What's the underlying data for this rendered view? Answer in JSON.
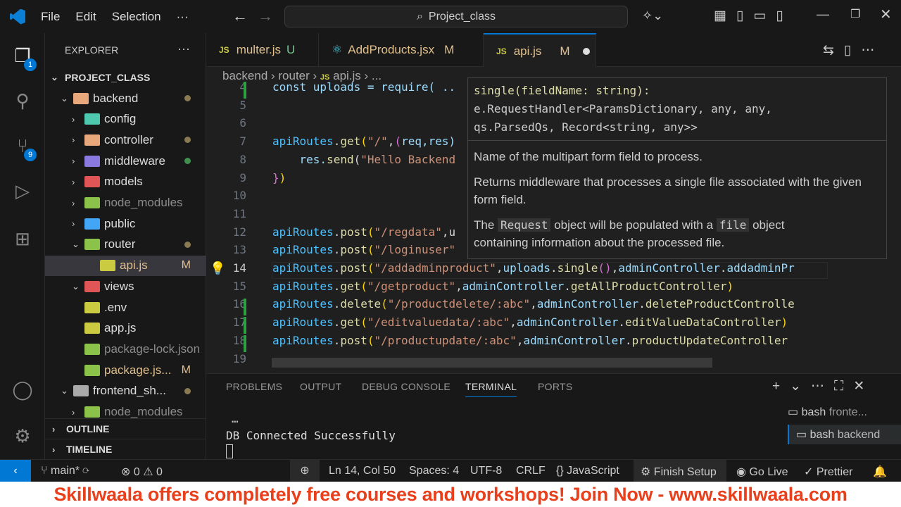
{
  "titlebar": {
    "menu": [
      "File",
      "Edit",
      "Selection",
      "···"
    ],
    "search": "Project_class"
  },
  "activity": {
    "explorer_badge": "1",
    "scm_badge": "9"
  },
  "sidebar": {
    "title": "EXPLORER",
    "more": "···",
    "project": "PROJECT_CLASS",
    "items": [
      {
        "label": "backend",
        "depth": 1,
        "chev": "⌄",
        "color": "#e8a87c",
        "dot": true
      },
      {
        "label": "config",
        "depth": 2,
        "chev": "›",
        "color": "#4ec9b0"
      },
      {
        "label": "controller",
        "depth": 2,
        "chev": "›",
        "color": "#e8a87c",
        "dot": true
      },
      {
        "label": "middleware",
        "depth": 2,
        "chev": "›",
        "color": "#8a7ae0",
        "dot": true,
        "green": true
      },
      {
        "label": "models",
        "depth": 2,
        "chev": "›",
        "color": "#e05555"
      },
      {
        "label": "node_modules",
        "depth": 2,
        "chev": "›",
        "color": "#8bc34a",
        "dim": true
      },
      {
        "label": "public",
        "depth": 2,
        "chev": "›",
        "color": "#42a5f5"
      },
      {
        "label": "router",
        "depth": 2,
        "chev": "⌄",
        "color": "#8bc34a",
        "dot": true
      },
      {
        "label": "api.js",
        "depth": 3,
        "chev": "",
        "color": "#cbcb41",
        "badge": "M",
        "selected": true
      },
      {
        "label": "views",
        "depth": 2,
        "chev": "⌄",
        "color": "#e05555"
      },
      {
        "label": ".env",
        "depth": 2,
        "chev": "",
        "color": "#cbcb41"
      },
      {
        "label": "app.js",
        "depth": 2,
        "chev": "",
        "color": "#cbcb41"
      },
      {
        "label": "package-lock.json",
        "depth": 2,
        "chev": "",
        "color": "#8bc34a",
        "dim": true
      },
      {
        "label": "package.js...",
        "depth": 2,
        "chev": "",
        "color": "#8bc34a",
        "badge": "M"
      },
      {
        "label": "frontend_sh...",
        "depth": 1,
        "chev": "⌄",
        "color": "#aaa",
        "dot": true
      },
      {
        "label": "node_modules",
        "depth": 2,
        "chev": "›",
        "color": "#8bc34a",
        "dim": true
      }
    ],
    "outline": "OUTLINE",
    "timeline": "TIMELINE"
  },
  "tabs": [
    {
      "label": "multer.js",
      "status": "U"
    },
    {
      "label": "AddProducts.jsx",
      "status": "M"
    },
    {
      "label": "api.js",
      "status": "M",
      "active": true
    }
  ],
  "breadcrumb": [
    "backend",
    "router",
    "api.js",
    "..."
  ],
  "editor": {
    "lines": [
      {
        "n": "4",
        "tokens": [
          [
            "const uploads = require( ..",
            "v"
          ]
        ]
      },
      {
        "n": "5",
        "tokens": []
      },
      {
        "n": "6",
        "tokens": []
      },
      {
        "n": "7",
        "tokens": [
          [
            "apiRoutes",
            "k"
          ],
          [
            ".",
            ""
          ],
          [
            "get",
            "f"
          ],
          [
            "(",
            "p"
          ],
          [
            "\"/\"",
            "s"
          ],
          [
            ",",
            ""
          ],
          [
            "(",
            "pk"
          ],
          [
            "req,res)",
            "v"
          ]
        ]
      },
      {
        "n": "8",
        "tokens": [
          [
            "    res.",
            "v"
          ],
          [
            "send",
            "f"
          ],
          [
            "(",
            ""
          ],
          [
            "\"Hello Backend",
            "s"
          ]
        ]
      },
      {
        "n": "9",
        "tokens": [
          [
            "}",
            "pk"
          ],
          [
            ")",
            "p"
          ]
        ]
      },
      {
        "n": "10",
        "tokens": []
      },
      {
        "n": "11",
        "tokens": []
      },
      {
        "n": "12",
        "tokens": [
          [
            "apiRoutes",
            "k"
          ],
          [
            ".",
            ""
          ],
          [
            "post",
            "f"
          ],
          [
            "(",
            "p"
          ],
          [
            "\"/regdata\"",
            "s"
          ],
          [
            ",u",
            ""
          ]
        ]
      },
      {
        "n": "13",
        "tokens": [
          [
            "apiRoutes",
            "k"
          ],
          [
            ".",
            ""
          ],
          [
            "post",
            "f"
          ],
          [
            "(",
            "p"
          ],
          [
            "\"/loginuser\"",
            "s"
          ]
        ]
      },
      {
        "n": "14",
        "tokens": [
          [
            "apiRoutes",
            "k"
          ],
          [
            ".",
            ""
          ],
          [
            "post",
            "f"
          ],
          [
            "(",
            "p"
          ],
          [
            "\"/addadminproduct\"",
            "s"
          ],
          [
            ",",
            ""
          ],
          [
            "uploads",
            "v"
          ],
          [
            ".",
            ""
          ],
          [
            "single",
            "f"
          ],
          [
            "()",
            "pk"
          ],
          [
            ",",
            ""
          ],
          [
            "adminController",
            "v"
          ],
          [
            ".",
            ""
          ],
          [
            "addadminPr",
            "v"
          ]
        ]
      },
      {
        "n": "15",
        "tokens": [
          [
            "apiRoutes",
            "k"
          ],
          [
            ".",
            ""
          ],
          [
            "get",
            "f"
          ],
          [
            "(",
            "p"
          ],
          [
            "\"/getproduct\"",
            "s"
          ],
          [
            ",",
            ""
          ],
          [
            "adminController",
            "v"
          ],
          [
            ".",
            ""
          ],
          [
            "getAllProductController",
            "f"
          ],
          [
            ")",
            "p"
          ]
        ]
      },
      {
        "n": "16",
        "tokens": [
          [
            "apiRoutes",
            "k"
          ],
          [
            ".",
            ""
          ],
          [
            "delete",
            "f"
          ],
          [
            "(",
            "p"
          ],
          [
            "\"/productdelete/:abc\"",
            "s"
          ],
          [
            ",",
            ""
          ],
          [
            "adminController",
            "v"
          ],
          [
            ".",
            ""
          ],
          [
            "deleteProductControlle",
            "f"
          ]
        ]
      },
      {
        "n": "17",
        "tokens": [
          [
            "apiRoutes",
            "k"
          ],
          [
            ".",
            ""
          ],
          [
            "get",
            "f"
          ],
          [
            "(",
            "p"
          ],
          [
            "\"/editvaluedata/:abc\"",
            "s"
          ],
          [
            ",",
            ""
          ],
          [
            "adminController",
            "v"
          ],
          [
            ".",
            ""
          ],
          [
            "editValueDataController",
            "f"
          ],
          [
            ")",
            "p"
          ]
        ]
      },
      {
        "n": "18",
        "tokens": [
          [
            "apiRoutes",
            "k"
          ],
          [
            ".",
            ""
          ],
          [
            "post",
            "f"
          ],
          [
            "(",
            "p"
          ],
          [
            "\"/productupdate/:abc\"",
            "s"
          ],
          [
            ",",
            ""
          ],
          [
            "adminController",
            "v"
          ],
          [
            ".",
            ""
          ],
          [
            "productUpdateController",
            "f"
          ]
        ]
      },
      {
        "n": "19",
        "tokens": []
      }
    ]
  },
  "hover": {
    "sig1": "single(fieldName: string):",
    "sig2": "e.RequestHandler<ParamsDictionary, any, any,",
    "sig3": "qs.ParsedQs, Record<string, any>>",
    "p1": "Name of the multipart form field to process.",
    "p2": "Returns middleware that processes a single file associated with the given form field.",
    "p3a": "The",
    "p3code1": "Request",
    "p3b": "object will be populated with a",
    "p3code2": "file",
    "p3c": "object",
    "p3d": "containing information about the processed file."
  },
  "panel": {
    "tabs": [
      "PROBLEMS",
      "OUTPUT",
      "DEBUG CONSOLE",
      "TERMINAL",
      "PORTS"
    ],
    "ellipsis": "…",
    "output": "DB Connected Successfully",
    "terminals": [
      {
        "name": "bash",
        "label": "fronte..."
      },
      {
        "name": "bash",
        "label": "backend"
      }
    ]
  },
  "statusbar": {
    "branch": "main*",
    "errors": "0",
    "warnings": "0",
    "position": "Ln 14, Col 50",
    "spaces": "Spaces: 4",
    "encoding": "UTF-8",
    "eol": "CRLF",
    "language": "JavaScript",
    "finish": "Finish Setup",
    "golive": "Go Live",
    "prettier": "Prettier"
  },
  "banner": "Skillwaala offers completely free courses and workshops! Join Now - www.skillwaala.com"
}
